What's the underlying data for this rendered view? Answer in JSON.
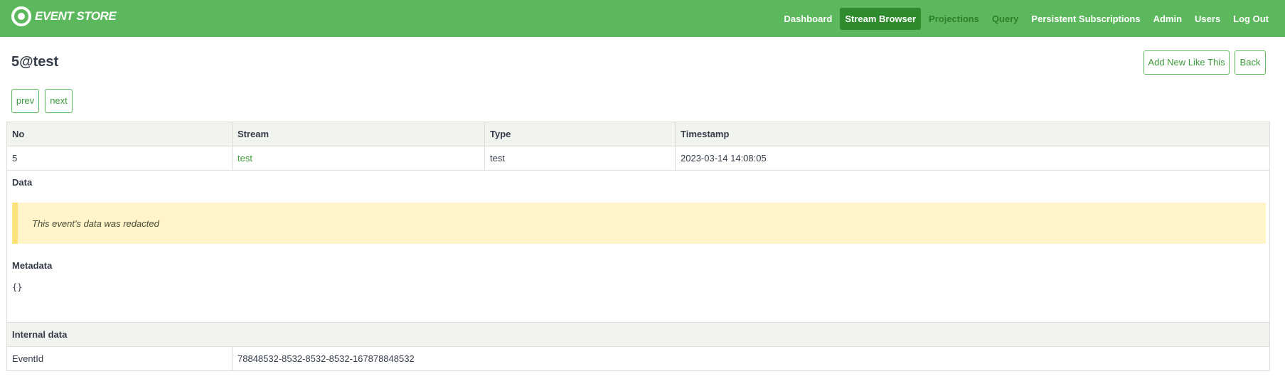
{
  "header": {
    "logo_text": "EVENT STORE",
    "nav": [
      {
        "label": "Dashboard"
      },
      {
        "label": "Stream Browser"
      },
      {
        "label": "Projections"
      },
      {
        "label": "Query"
      },
      {
        "label": "Persistent Subscriptions"
      },
      {
        "label": "Admin"
      },
      {
        "label": "Users"
      },
      {
        "label": "Log Out"
      }
    ]
  },
  "page": {
    "title": "5@test",
    "actions": {
      "add_new": "Add New Like This",
      "back": "Back"
    },
    "paging": {
      "prev": "prev",
      "next": "next"
    }
  },
  "event_table": {
    "columns": [
      "No",
      "Stream",
      "Type",
      "Timestamp"
    ],
    "row": {
      "no": "5",
      "stream": "test",
      "type": "test",
      "timestamp": "2023-03-14 14:08:05"
    }
  },
  "data_section": {
    "label": "Data",
    "notice": "This event's data was redacted"
  },
  "metadata_section": {
    "label": "Metadata",
    "value": "{}"
  },
  "internal": {
    "label": "Internal data",
    "event_id_label": "EventId",
    "event_id_value": "78848532-8532-8532-8532-167878848532"
  },
  "colors": {
    "brand_green": "#5cb85c",
    "active_nav": "#2e8b2e",
    "notice_bg": "#fff5c9"
  }
}
